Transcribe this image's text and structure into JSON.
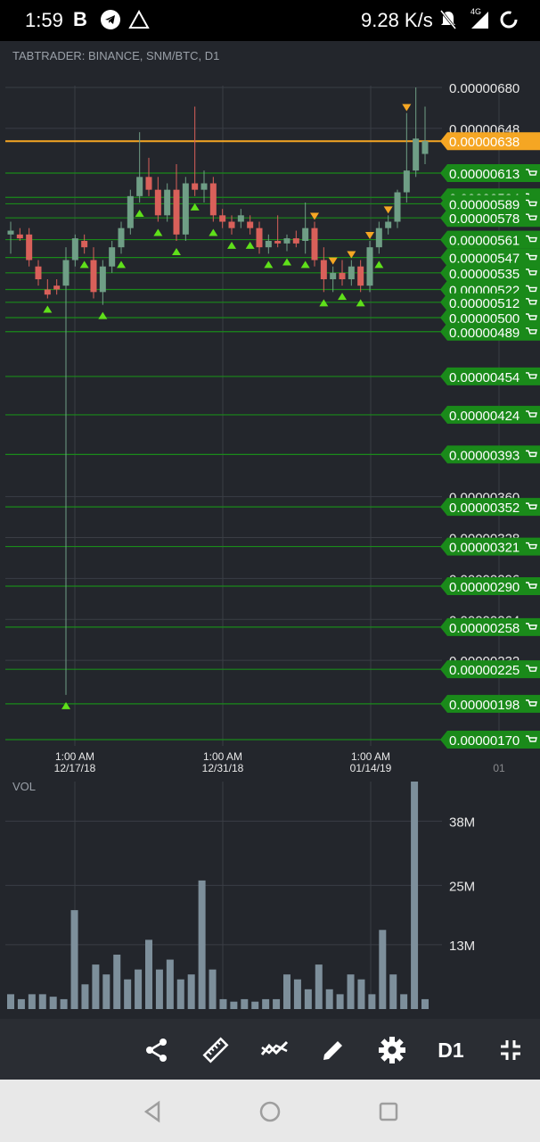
{
  "status_bar": {
    "time": "1:59",
    "app_letter": "B",
    "icons": [
      "telegram-icon",
      "warning-triangle-icon"
    ],
    "net_speed": "9.28 K/s",
    "right_icons": [
      "bell-off-icon",
      "4g-signal-icon",
      "battery-charging-icon"
    ],
    "network_badge": "4G"
  },
  "chart": {
    "title": "TABTRADER: BINANCE, SNM/BTC, D1",
    "price_axis_labels": [
      "0.00000680",
      "0.00000648",
      "0.00000360",
      "0.00000328",
      "0.00000296",
      "0.00000264",
      "0.00000232"
    ],
    "current_price": "0.00000638",
    "current_price_color": "#f5a623",
    "buy_order_color": "#1a8a1a",
    "up_candle_color": "#6f9e86",
    "down_candle_color": "#d9605a",
    "buy_orders": [
      "0.00000613",
      "0.00000594",
      "0.00000589",
      "0.00000578",
      "0.00000561",
      "0.00000547",
      "0.00000535",
      "0.00000522",
      "0.00000512",
      "0.00000500",
      "0.00000489",
      "0.00000454",
      "0.00000424",
      "0.00000393",
      "0.00000352",
      "0.00000321",
      "0.00000290",
      "0.00000258",
      "0.00000225",
      "0.00000198",
      "0.00000170"
    ],
    "time_axis": [
      {
        "time": "1:00 AM",
        "date": "12/17/18"
      },
      {
        "time": "1:00 AM",
        "date": "12/31/18"
      },
      {
        "time": "1:00 AM",
        "date": "01/14/19"
      },
      {
        "time": "",
        "date": "01"
      }
    ]
  },
  "volume": {
    "title": "VOL",
    "axis_labels": [
      "38M",
      "25M",
      "13M"
    ],
    "bar_color": "#7d8f9b"
  },
  "chart_data": [
    {
      "type": "candlestick",
      "title": "TABTRADER: BINANCE, SNM/BTC, D1",
      "xlabel": "",
      "ylabel": "",
      "x_ticks": [
        "12/17/18",
        "12/31/18",
        "01/14/19"
      ],
      "ylim": [
        1.7e-06,
        6.9e-06
      ],
      "candles": [
        {
          "o": 5.65e-06,
          "h": 5.75e-06,
          "l": 5.5e-06,
          "c": 5.68e-06
        },
        {
          "o": 5.65e-06,
          "h": 5.7e-06,
          "l": 5.6e-06,
          "c": 5.62e-06
        },
        {
          "o": 5.65e-06,
          "h": 5.7e-06,
          "l": 5.4e-06,
          "c": 5.45e-06
        },
        {
          "o": 5.4e-06,
          "h": 5.45e-06,
          "l": 5.25e-06,
          "c": 5.3e-06
        },
        {
          "o": 5.22e-06,
          "h": 5.3e-06,
          "l": 5.15e-06,
          "c": 5.18e-06
        },
        {
          "o": 5.25e-06,
          "h": 5.3e-06,
          "l": 5.18e-06,
          "c": 5.22e-06
        },
        {
          "o": 5.25e-06,
          "h": 5.55e-06,
          "l": 2.05e-06,
          "c": 5.45e-06
        },
        {
          "o": 5.45e-06,
          "h": 5.65e-06,
          "l": 5.4e-06,
          "c": 5.62e-06
        },
        {
          "o": 5.6e-06,
          "h": 5.65e-06,
          "l": 5.5e-06,
          "c": 5.55e-06
        },
        {
          "o": 5.45e-06,
          "h": 5.55e-06,
          "l": 5.15e-06,
          "c": 5.2e-06
        },
        {
          "o": 5.2e-06,
          "h": 5.45e-06,
          "l": 5.1e-06,
          "c": 5.4e-06
        },
        {
          "o": 5.4e-06,
          "h": 5.6e-06,
          "l": 5.35e-06,
          "c": 5.55e-06
        },
        {
          "o": 5.55e-06,
          "h": 5.75e-06,
          "l": 5.5e-06,
          "c": 5.7e-06
        },
        {
          "o": 5.7e-06,
          "h": 6e-06,
          "l": 5.65e-06,
          "c": 5.95e-06
        },
        {
          "o": 5.95e-06,
          "h": 6.45e-06,
          "l": 5.9e-06,
          "c": 6.1e-06
        },
        {
          "o": 6.1e-06,
          "h": 6.25e-06,
          "l": 5.95e-06,
          "c": 6e-06
        },
        {
          "o": 6e-06,
          "h": 6.1e-06,
          "l": 5.75e-06,
          "c": 5.8e-06
        },
        {
          "o": 5.8e-06,
          "h": 6.05e-06,
          "l": 5.75e-06,
          "c": 6e-06
        },
        {
          "o": 6e-06,
          "h": 6.2e-06,
          "l": 5.6e-06,
          "c": 5.65e-06
        },
        {
          "o": 5.65e-06,
          "h": 6.1e-06,
          "l": 5.6e-06,
          "c": 6.05e-06
        },
        {
          "o": 6.05e-06,
          "h": 6.65e-06,
          "l": 5.95e-06,
          "c": 6e-06
        },
        {
          "o": 6e-06,
          "h": 6.15e-06,
          "l": 5.9e-06,
          "c": 6.05e-06
        },
        {
          "o": 6.05e-06,
          "h": 6.1e-06,
          "l": 5.75e-06,
          "c": 5.8e-06
        },
        {
          "o": 5.8e-06,
          "h": 5.85e-06,
          "l": 5.7e-06,
          "c": 5.75e-06
        },
        {
          "o": 5.75e-06,
          "h": 5.8e-06,
          "l": 5.65e-06,
          "c": 5.7e-06
        },
        {
          "o": 5.75e-06,
          "h": 5.85e-06,
          "l": 5.7e-06,
          "c": 5.8e-06
        },
        {
          "o": 5.75e-06,
          "h": 5.8e-06,
          "l": 5.65e-06,
          "c": 5.7e-06
        },
        {
          "o": 5.7e-06,
          "h": 5.75e-06,
          "l": 5.5e-06,
          "c": 5.55e-06
        },
        {
          "o": 5.55e-06,
          "h": 5.65e-06,
          "l": 5.5e-06,
          "c": 5.6e-06
        },
        {
          "o": 5.6e-06,
          "h": 5.8e-06,
          "l": 5.55e-06,
          "c": 5.58e-06
        },
        {
          "o": 5.58e-06,
          "h": 5.65e-06,
          "l": 5.52e-06,
          "c": 5.62e-06
        },
        {
          "o": 5.62e-06,
          "h": 5.68e-06,
          "l": 5.55e-06,
          "c": 5.58e-06
        },
        {
          "o": 5.6e-06,
          "h": 5.9e-06,
          "l": 5.5e-06,
          "c": 5.7e-06
        },
        {
          "o": 5.7e-06,
          "h": 5.75e-06,
          "l": 5.4e-06,
          "c": 5.45e-06
        },
        {
          "o": 5.45e-06,
          "h": 5.55e-06,
          "l": 5.2e-06,
          "c": 5.3e-06
        },
        {
          "o": 5.3e-06,
          "h": 5.4e-06,
          "l": 5.2e-06,
          "c": 5.35e-06
        },
        {
          "o": 5.35e-06,
          "h": 5.45e-06,
          "l": 5.25e-06,
          "c": 5.3e-06
        },
        {
          "o": 5.3e-06,
          "h": 5.45e-06,
          "l": 5.25e-06,
          "c": 5.4e-06
        },
        {
          "o": 5.4e-06,
          "h": 5.45e-06,
          "l": 5.2e-06,
          "c": 5.25e-06
        },
        {
          "o": 5.25e-06,
          "h": 5.6e-06,
          "l": 5.2e-06,
          "c": 5.55e-06
        },
        {
          "o": 5.55e-06,
          "h": 5.75e-06,
          "l": 5.5e-06,
          "c": 5.7e-06
        },
        {
          "o": 5.7e-06,
          "h": 5.8e-06,
          "l": 5.65e-06,
          "c": 5.75e-06
        },
        {
          "o": 5.75e-06,
          "h": 6e-06,
          "l": 5.7e-06,
          "c": 5.98e-06
        },
        {
          "o": 5.98e-06,
          "h": 6.6e-06,
          "l": 5.9e-06,
          "c": 6.15e-06
        },
        {
          "o": 6.15e-06,
          "h": 6.8e-06,
          "l": 6.1e-06,
          "c": 6.4e-06
        },
        {
          "o": 6.28e-06,
          "h": 6.65e-06,
          "l": 6.2e-06,
          "c": 6.38e-06
        }
      ]
    },
    {
      "type": "bar",
      "title": "VOL",
      "ylim": [
        0,
        46
      ],
      "unit": "M",
      "values": [
        3,
        2,
        3,
        3,
        2.5,
        2,
        20,
        5,
        9,
        7,
        11,
        6,
        8,
        14,
        8,
        10,
        6,
        7,
        26,
        8,
        2,
        1.5,
        2,
        1.5,
        2,
        2,
        7,
        6,
        4,
        9,
        4,
        3,
        7,
        6,
        3,
        16,
        7,
        3,
        46,
        2
      ]
    }
  ],
  "toolbar": {
    "items": [
      {
        "icon": "share-icon"
      },
      {
        "icon": "ruler-icon"
      },
      {
        "icon": "indicator-icon"
      },
      {
        "icon": "pencil-icon"
      },
      {
        "icon": "gear-icon"
      },
      {
        "label": "D1"
      },
      {
        "icon": "fullscreen-exit-icon"
      }
    ]
  },
  "navbar": {
    "items": [
      "back-icon",
      "home-icon",
      "recents-icon"
    ]
  }
}
